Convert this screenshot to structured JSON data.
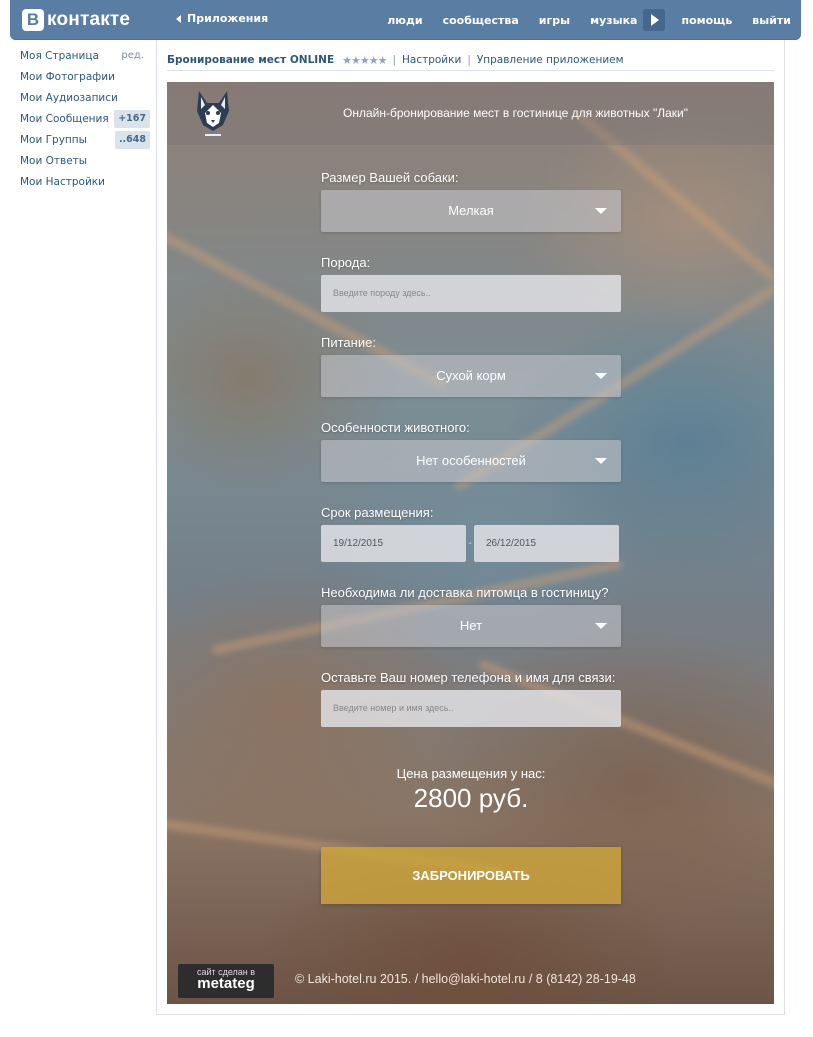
{
  "topbar": {
    "logo_letter": "В",
    "logo_text": "контакте",
    "apps_label": "Приложения",
    "nav": [
      "люди",
      "сообщества",
      "игры",
      "музыка",
      "помощь",
      "выйти"
    ]
  },
  "sidebar": {
    "items": [
      {
        "label": "Моя Страница",
        "extra": "ред."
      },
      {
        "label": "Мои Фотографии"
      },
      {
        "label": "Мои Аудиозаписи"
      },
      {
        "label": "Мои Сообщения",
        "badge": "+167"
      },
      {
        "label": "Мои Группы",
        "badge": "..648"
      },
      {
        "label": "Мои Ответы"
      },
      {
        "label": "Мои Настройки"
      }
    ]
  },
  "app_header": {
    "title": "Бронирование мест ONLINE",
    "stars": "★★★★★",
    "separator": "|",
    "settings": "Настройки",
    "manage": "Управление приложением"
  },
  "app": {
    "title": "Онлайн-бронирование мест в гостинице для животных \"Лаки\"",
    "fields": {
      "size_label": "Размер Вашей собаки:",
      "size_value": "Мелкая",
      "breed_label": "Порода:",
      "breed_placeholder": "Введите породу здесь..",
      "food_label": "Питание:",
      "food_value": "Сухой корм",
      "features_label": "Особенности животного:",
      "features_value": "Нет особенностей",
      "period_label": "Срок размещения:",
      "date_from": "19/12/2015",
      "date_sep": "-",
      "date_to": "26/12/2015",
      "delivery_label": "Необходима ли доставка питомца в гостиницу?",
      "delivery_value": "Нет",
      "contact_label": "Оставьте Ваш номер телефона и имя для связи:",
      "contact_placeholder": "Введите номер и имя здесь.."
    },
    "price_label": "Цена размещения у нас:",
    "price_value": "2800 руб.",
    "book_button": "ЗАБРОНИРОВАТЬ",
    "made_by_line1": "сайт сделан в",
    "made_by_line2": "metateg",
    "footer": "© Laki-hotel.ru 2015. / hello@laki-hotel.ru / 8 (8142) 28-19-48"
  }
}
